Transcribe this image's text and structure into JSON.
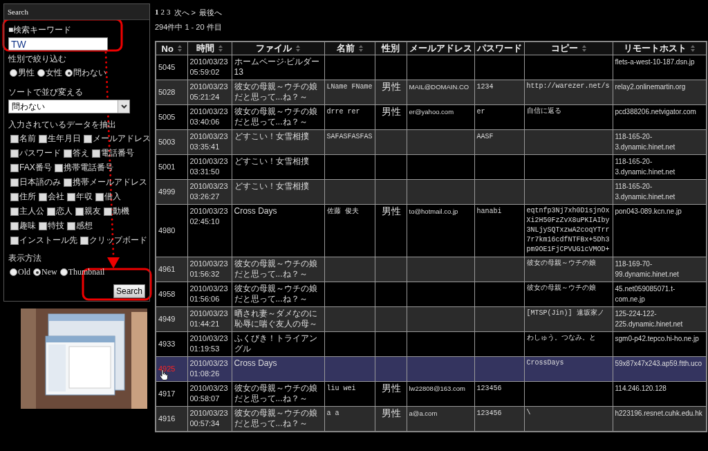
{
  "search_panel": {
    "title": "Search",
    "keyword": {
      "label": "■検索キーワード",
      "value": "TW"
    },
    "gender": {
      "label": "性別で絞り込む",
      "options": [
        {
          "label": "男性",
          "selected": false
        },
        {
          "label": "女性",
          "selected": false
        },
        {
          "label": "問わない",
          "selected": true
        }
      ]
    },
    "sort": {
      "label": "ソートで並び変える",
      "value": "問わない"
    },
    "extract": {
      "label": "入力されているデータを抽出",
      "rows": [
        [
          {
            "label": "名前",
            "checked": false
          },
          {
            "label": "生年月日",
            "checked": false
          },
          {
            "label": "メールアドレス",
            "checked": false
          }
        ],
        [
          {
            "label": "パスワード",
            "checked": false
          },
          {
            "label": "答え",
            "checked": false
          },
          {
            "label": "電話番号",
            "checked": false
          }
        ],
        [
          {
            "label": "FAX番号",
            "checked": false
          },
          {
            "label": "携帯電話番号",
            "checked": false
          }
        ],
        [
          {
            "label": "日本語のみ",
            "checked": false
          },
          {
            "label": "携帯メールアドレス",
            "checked": false
          }
        ],
        [
          {
            "label": "住所",
            "checked": false
          },
          {
            "label": "会社",
            "checked": false
          },
          {
            "label": "年収",
            "checked": false
          },
          {
            "label": "借入",
            "checked": false
          }
        ],
        [
          {
            "label": "主人公",
            "checked": false
          },
          {
            "label": "恋人",
            "checked": false
          },
          {
            "label": "親友",
            "checked": false
          },
          {
            "label": "動機",
            "checked": false
          }
        ],
        [
          {
            "label": "趣味",
            "checked": false
          },
          {
            "label": "特技",
            "checked": false
          },
          {
            "label": "感想",
            "checked": false
          }
        ],
        [
          {
            "label": "インストール先",
            "checked": false
          },
          {
            "label": "クリップボード",
            "checked": false
          }
        ]
      ]
    },
    "display": {
      "label": "表示方法",
      "options": [
        {
          "label": "Old",
          "selected": false
        },
        {
          "label": "New",
          "selected": true
        },
        {
          "label": "Thumbnail",
          "selected": false
        }
      ]
    },
    "button": "Search"
  },
  "pagination": {
    "pages": [
      {
        "label": "1",
        "selected": true
      },
      {
        "label": "2",
        "selected": false
      },
      {
        "label": "3",
        "selected": false
      }
    ],
    "next": "次へ >",
    "last": "最後へ"
  },
  "summary": "294件中 1 - 20 件目",
  "table": {
    "columns": [
      {
        "label": "No",
        "sortable": true
      },
      {
        "label": "時間",
        "sortable": true
      },
      {
        "label": "ファイル",
        "sortable": true
      },
      {
        "label": "名前",
        "sortable": true
      },
      {
        "label": "性別",
        "sortable": false
      },
      {
        "label": "メールアドレス",
        "sortable": false
      },
      {
        "label": "パスワード",
        "sortable": false
      },
      {
        "label": "コピー",
        "sortable": true
      },
      {
        "label": "リモートホスト",
        "sortable": true
      }
    ],
    "rows": [
      {
        "selected": false,
        "no": "5045",
        "time": "2010/03/23 05:59:02",
        "file": "ホームページ·ビルダー13",
        "host": "flets-a-west-10-187.dsn.jp"
      },
      {
        "selected": false,
        "no": "5028",
        "time": "2010/03/23 05:21:24",
        "file": "彼女の母親～ウチの娘だと思って...ね？～",
        "name": "LName FName",
        "gender": "男性",
        "mail": "MAIL@DOMAIN.CO",
        "password": "1234",
        "copy": "http://warezer.net/s",
        "host": "relay2.onlinemartin.org"
      },
      {
        "selected": false,
        "no": "5005",
        "time": "2010/03/23 03:40:06",
        "file": "彼女の母親～ウチの娘だと思って...ね？～",
        "name": "drre rer",
        "gender": "男性",
        "mail": "er@yahoo.com",
        "password": "er",
        "copy": "自信に返る",
        "host": "pcd388206.netvigator.com"
      },
      {
        "selected": false,
        "no": "5003",
        "time": "2010/03/23 03:35:41",
        "file": "どすこい！女雪相撲",
        "name": "SAFASFASFAS",
        "password": "AASF",
        "host": "118-165-20-3.dynamic.hinet.net"
      },
      {
        "selected": false,
        "no": "5001",
        "time": "2010/03/23 03:31:50",
        "file": "どすこい！女雪相撲",
        "host": "118-165-20-3.dynamic.hinet.net"
      },
      {
        "selected": false,
        "no": "4999",
        "time": "2010/03/23 03:26:27",
        "file": "どすこい！女雪相撲",
        "host": "118-165-20-3.dynamic.hinet.net"
      },
      {
        "selected": false,
        "no": "4980",
        "time": "2010/03/23 02:45:10",
        "file": "Cross Days",
        "name": "佐藤 俊夫",
        "gender": "男性",
        "mail": "to@hotmail.co.jp",
        "password": "hanabi",
        "copy": "eqtnfp3Nj7xh0D1sjnOx Xi2H50FzZvX8uPKIAIby 3NLjySQTxzwA2coqYTrr 7r7km16cdfNTFBx+5Dh3 pm9OE1FjCPVUG1cVMOD+",
        "host": "pon043-089.kcn.ne.jp"
      },
      {
        "selected": false,
        "no": "4961",
        "time": "2010/03/23 01:56:32",
        "file": "彼女の母親～ウチの娘だと思って...ね？～",
        "copy": "彼女の母親～ウチの娘",
        "host": "118-169-70-99.dynamic.hinet.net"
      },
      {
        "selected": false,
        "no": "4958",
        "time": "2010/03/23 01:56:06",
        "file": "彼女の母親～ウチの娘だと思って...ね？～",
        "copy": "彼女の母親～ウチの娘",
        "host": "45.net059085071.t-com.ne.jp"
      },
      {
        "selected": false,
        "no": "4949",
        "time": "2010/03/23 01:44:21",
        "file": "晒され妻～ダメなのに恥辱に喘ぐ友人の母～",
        "copy": "[MTSP(Jin)] 遠坂家ノ",
        "host": "125-224-122-225.dynamic.hinet.net"
      },
      {
        "selected": false,
        "no": "4933",
        "time": "2010/03/23 01:19:53",
        "file": "ふくびき！トライアングル",
        "copy": "わしゅう。つなみ。と",
        "host": "sgm0-p42.tepco.hi-ho.ne.jp"
      },
      {
        "selected": true,
        "no": "4925",
        "time": "2010/03/23 01:08:26",
        "file": "Cross Days",
        "copy": "CrossDays",
        "host": "59x87x47x243.ap59.ftth.uco"
      },
      {
        "selected": false,
        "no": "4917",
        "time": "2010/03/23 00:58:07",
        "file": "彼女の母親～ウチの娘だと思って...ね？～",
        "name": "liu wei",
        "gender": "男性",
        "mail": "lw22808@163.com",
        "password": "123456",
        "host": "114.246.120.128"
      },
      {
        "selected": false,
        "no": "4916",
        "time": "2010/03/23 00:57:34",
        "file": "彼女の母親～ウチの娘だと思って...ね？～",
        "name": "a a",
        "gender": "男性",
        "mail": "a@a.com",
        "password": "123456",
        "copy": "\\",
        "host": "h223196.resnet.cuhk.edu.hk"
      }
    ]
  }
}
